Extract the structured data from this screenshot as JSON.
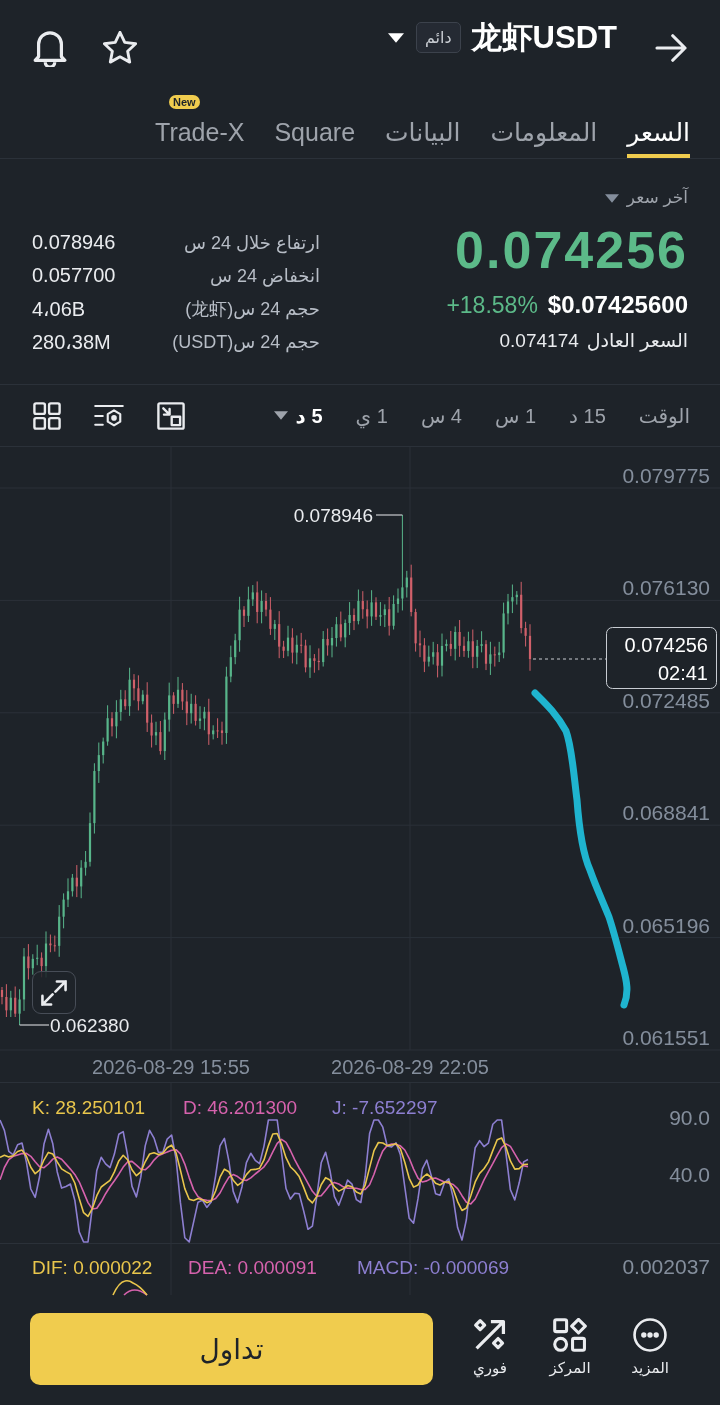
{
  "header": {
    "title": "龙虾USDT",
    "badge": "دائم"
  },
  "tabs": [
    {
      "label": "السعر",
      "selected": true
    },
    {
      "label": "المعلومات",
      "selected": false
    },
    {
      "label": "البيانات",
      "selected": false
    },
    {
      "label": "Square",
      "selected": false
    },
    {
      "label": "Trade-X",
      "selected": false,
      "badge": "New"
    }
  ],
  "price": {
    "selector": "آخر سعر",
    "last": "0.074256",
    "usd": "$0.07425600",
    "change": "+18.58%",
    "fair_label": "السعر العادل",
    "fair_value": "0.074174"
  },
  "stats": [
    {
      "label": "ارتفاع خلال 24 س",
      "value": "0.078946"
    },
    {
      "label": "انخفاض 24 س",
      "value": "0.057700"
    },
    {
      "label": "حجم 24 س(龙虾)",
      "value": "4،06B"
    },
    {
      "label": "حجم 24 س(USDT)",
      "value": "280،38M"
    }
  ],
  "intervals": [
    {
      "label": "الوقت",
      "selected": false,
      "kind": "tab"
    },
    {
      "label": "15 د",
      "selected": false,
      "kind": "tab"
    },
    {
      "label": "1 س",
      "selected": false,
      "kind": "tab"
    },
    {
      "label": "4 س",
      "selected": false,
      "kind": "tab"
    },
    {
      "label": "1 ي",
      "selected": false,
      "kind": "tab"
    },
    {
      "label": "5 د",
      "selected": true,
      "kind": "dropdown"
    }
  ],
  "chart": {
    "price_axis": [
      "0.079775",
      "0.076130",
      "0.072485",
      "0.068841",
      "0.065196",
      "0.061551"
    ],
    "time_axis": [
      "2026-08-29 22:05",
      "2026-08-29 15:55"
    ],
    "high_label": "0.078946",
    "low_label": "0.062380",
    "last_price": "0.074256",
    "countdown": "02:41"
  },
  "kdj": {
    "axis": [
      "90.0",
      "40.0"
    ],
    "lines": [
      {
        "label": "J: -7.652297",
        "color": "#8d7fd1"
      },
      {
        "label": "D: 46.201300",
        "color": "#d662ad"
      },
      {
        "label": "K: 28.250101",
        "color": "#e9c64c"
      }
    ]
  },
  "macd": {
    "axis": [
      "0.002037"
    ],
    "lines": [
      {
        "label": "MACD: -0.000069",
        "color": "#8d7fd1"
      },
      {
        "label": "DEA: 0.000091",
        "color": "#d662ad"
      },
      {
        "label": "DIF: 0.000022",
        "color": "#e9c64c"
      }
    ]
  },
  "bottom": {
    "trade": "تداول",
    "actions": [
      {
        "label": "المزيد",
        "kind": "more"
      },
      {
        "label": "المركز",
        "kind": "positions"
      },
      {
        "label": "فوري",
        "kind": "instant"
      }
    ]
  }
}
